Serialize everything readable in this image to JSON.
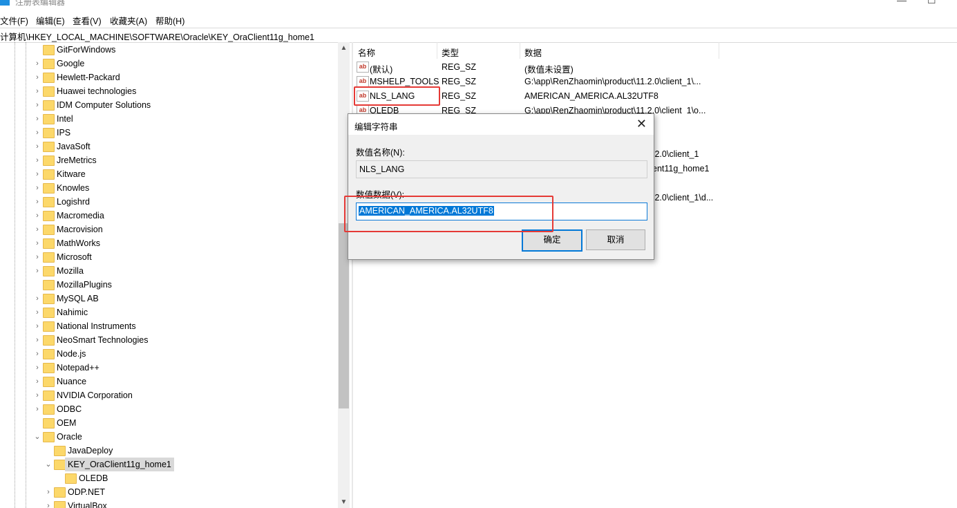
{
  "window": {
    "title": "注册表编辑器"
  },
  "menu": [
    "文件(F)",
    "编辑(E)",
    "查看(V)",
    "收藏夹(A)",
    "帮助(H)"
  ],
  "address": "计算机\\HKEY_LOCAL_MACHINE\\SOFTWARE\\Oracle\\KEY_OraClient11g_home1",
  "tree": [
    "GitForWindows",
    "Google",
    "Hewlett-Packard",
    "Huawei technologies",
    "IDM Computer Solutions",
    "Intel",
    "IPS",
    "JavaSoft",
    "JreMetrics",
    "Kitware",
    "Knowles",
    "Logishrd",
    "Macromedia",
    "Macrovision",
    "MathWorks",
    "Microsoft",
    "Mozilla",
    "MozillaPlugins",
    "MySQL AB",
    "Nahimic",
    "National Instruments",
    "NeoSmart Technologies",
    "Node.js",
    "Notepad++",
    "Nuance",
    "NVIDIA Corporation",
    "ODBC",
    "OEM",
    "Oracle",
    "JavaDeploy",
    "KEY_OraClient11g_home1",
    "OLEDB",
    "ODP.NET",
    "VirtualBox"
  ],
  "list": {
    "headers": {
      "name": "名称",
      "type": "类型",
      "data": "数据"
    },
    "rows": [
      {
        "icon": "ab",
        "name": "(默认)",
        "type": "REG_SZ",
        "data": "(数值未设置)"
      },
      {
        "icon": "ab",
        "name": "MSHELP_TOOLS",
        "type": "REG_SZ",
        "data": "G:\\app\\RenZhaomin\\product\\11.2.0\\client_1\\..."
      },
      {
        "icon": "ab",
        "name": "NLS_LANG",
        "type": "REG_SZ",
        "data": "AMERICAN_AMERICA.AL32UTF8"
      },
      {
        "icon": "ab",
        "name": "OLEDB",
        "type": "REG_SZ",
        "data": "G:\\app\\RenZhaomin\\product\\11.2.0\\client_1\\o..."
      }
    ],
    "partial": [
      ".2.0\\client_1",
      "ent11g_home1",
      ".2.0\\client_1\\d..."
    ]
  },
  "dialog": {
    "title": "编辑字符串",
    "close": "✕",
    "name_label": "数值名称(N):",
    "name_value": "NLS_LANG",
    "data_label": "数值数据(V):",
    "data_value": "AMERICAN_AMERICA.AL32UTF8",
    "ok": "确定",
    "cancel": "取消"
  },
  "colors": {
    "highlight": "#e53935",
    "selection": "#0078d7",
    "folder": "#fcd86a"
  }
}
